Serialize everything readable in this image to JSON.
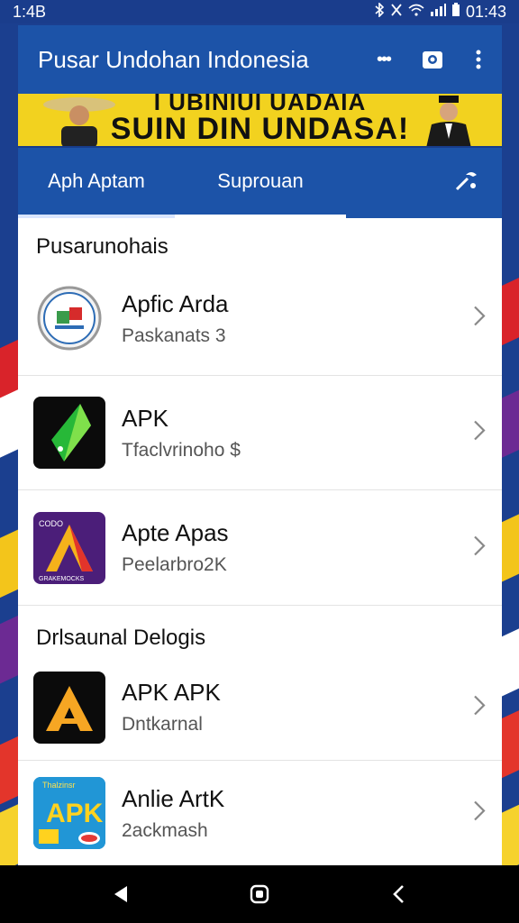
{
  "status": {
    "time_left": "1:4B",
    "time_right": "01:43",
    "icons": [
      "bluetooth-icon",
      "vibrate-icon",
      "wifi-icon",
      "signal-icon",
      "battery-icon"
    ]
  },
  "app_bar": {
    "title": "Pusar Undohan Indonesia",
    "more_label": "•••",
    "icons": [
      "camera-icon",
      "overflow-menu-icon"
    ]
  },
  "banner": {
    "line1": "I UBINIUI UADAIA",
    "line2": "SUIN DIN UNDASA!"
  },
  "tabs": [
    {
      "label": "Aph Aptam"
    },
    {
      "label": "Suprouan"
    }
  ],
  "sections": [
    {
      "header": "Pusarunohais",
      "items": [
        {
          "title": "Apfic Arda",
          "subtitle": "Paskanats 3",
          "icon": "badge-logo-icon"
        },
        {
          "title": "APK",
          "subtitle": "Tfaclvrinoho $",
          "icon": "green-crystal-icon"
        },
        {
          "title": "Apte Apas",
          "subtitle": "Peelarbro2K",
          "icon": "orange-a-logo-icon"
        }
      ]
    },
    {
      "header": "Drlsaunal Delogis",
      "items": [
        {
          "title": "APK APK",
          "subtitle": "Dntkarnal",
          "icon": "yellow-a-logo-icon"
        },
        {
          "title": "Anlie ArtK",
          "subtitle": "2ackmash",
          "icon": "apk-poster-icon"
        }
      ]
    }
  ],
  "item_icon_texts": {
    "purple_top": "CODO",
    "purple_bottom": "GRAKEMOCKS",
    "apk_top": "Thalzinsr",
    "apk_main": "APK"
  },
  "colors": {
    "primary": "#1c53a8",
    "banner_yellow": "#f2d21f",
    "nav": "#000000"
  }
}
